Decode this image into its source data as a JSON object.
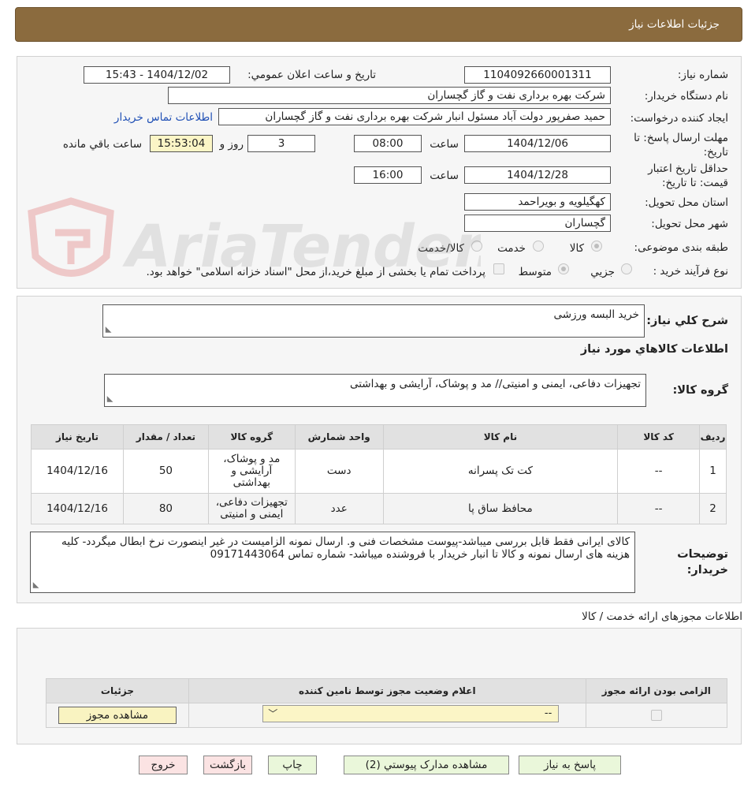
{
  "header": {
    "title": "جزئیات اطلاعات نیاز"
  },
  "watermark": {
    "text": "AriaTender.neT"
  },
  "form": {
    "need_number_label": "شماره نیاز:",
    "need_number": "1104092660001311",
    "announce_label": "تاریخ و ساعت اعلان عمومي:",
    "announce_value": "1404/12/02 - 15:43",
    "buyer_org_label": "نام دستگاه خريدار:",
    "buyer_org": "شرکت بهره برداری نفت و گاز گچساران",
    "requester_label": "ايجاد کننده درخواست:",
    "requester": "حمید  صفرپور دولت آباد مسئول انبار شرکت بهره برداری نفت و گاز گچساران",
    "contact_link": "اطلاعات تماس خريدار",
    "deadline_label_1": "مهلت ارسال پاسخ: تا",
    "deadline_label_2": "تاریخ:",
    "deadline_date": "1404/12/06",
    "time_label": "ساعت",
    "deadline_time": "08:00",
    "days_value": "3",
    "days_label": "روز و",
    "remaining_time": "15:53:04",
    "remaining_label": "ساعت باقي مانده",
    "validity_label_1": "حداقل تاريخ اعتبار",
    "validity_label_2": "قيمت: تا تاريخ:",
    "validity_date": "1404/12/28",
    "validity_time": "16:00",
    "province_label": "استان محل تحويل:",
    "province": "کهگیلویه و بویراحمد",
    "city_label": "شهر محل تحويل:",
    "city": "گچساران",
    "category_label": "طبقه بندی موضوعی:",
    "category_options": [
      "کالا",
      "خدمت",
      "کالا/خدمت"
    ],
    "process_label": "نوع فرآیند خرید :",
    "process_options": [
      "جزيي",
      "متوسط"
    ],
    "payment_note": "پرداخت تمام يا بخشی از مبلغ خريد،از محل \"اسناد خزانه اسلامی\" خواهد بود."
  },
  "general": {
    "desc_label": "شرح کلي نياز:",
    "desc": "خرید البسه ورزشی",
    "goods_info_title": "اطلاعات کالاهاي مورد نياز",
    "group_label": "گروه کالا:",
    "group_value": "تجهیزات دفاعی، ایمنی و امنیتی// مد و پوشاک، آرایشی و بهداشتی"
  },
  "items_table": {
    "headers": [
      "رديف",
      "کد کالا",
      "نام کالا",
      "واحد شمارش",
      "گروه کالا",
      "تعداد / مقدار",
      "تاریخ نیاز"
    ],
    "rows": [
      {
        "row": "1",
        "code": "--",
        "name": "کت تک پسرانه",
        "unit": "دست",
        "group": "مد و پوشاک، آرایشی و بهداشتی",
        "qty": "50",
        "date": "1404/12/16"
      },
      {
        "row": "2",
        "code": "--",
        "name": "محافظ ساق پا",
        "unit": "عدد",
        "group": "تجهیزات دفاعی، ایمنی و امنیتی",
        "qty": "80",
        "date": "1404/12/16"
      }
    ]
  },
  "buyer_notes": {
    "label": "توضيحات خريدار:",
    "text": "کالای ایرانی فقط قابل بررسی میباشد-پیوست مشخصات فنی و. ارسال نمونه الزامیست در غیر اینصورت نرخ ابطال میگردد- کلیه هزینه های ارسال نمونه و  کالا  تا انبار خریدار با فروشنده میباشد- شماره تماس 09171443064"
  },
  "license": {
    "title": "اطلاعات مجوزهای ارائه خدمت / کالا",
    "headers": [
      "الزامی بودن ارائه مجوز",
      "اعلام وضعیت مجوز توسط نامین کننده",
      "جزئیات"
    ],
    "select_value": "--",
    "view_button": "مشاهده مجوز"
  },
  "buttons": {
    "reply": "پاسخ به نیاز",
    "attachments": "مشاهده مدارک پیوستي (2)",
    "print": "چاپ",
    "back": "بازگشت",
    "exit": "خروج"
  }
}
